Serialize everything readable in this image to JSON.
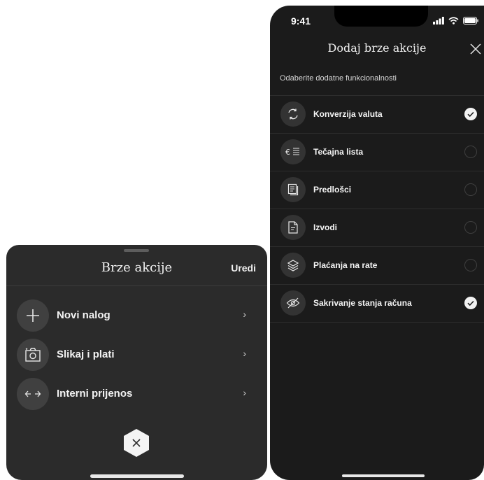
{
  "quick_actions_sheet": {
    "title": "Brze akcije",
    "edit_label": "Uredi",
    "items": [
      {
        "label": "Novi nalog",
        "icon": "plus-icon"
      },
      {
        "label": "Slikaj i plati",
        "icon": "camera-icon"
      },
      {
        "label": "Interni prijenos",
        "icon": "transfer-arrows-icon"
      }
    ],
    "close_icon": "close-icon"
  },
  "add_actions_screen": {
    "status_time": "9:41",
    "title": "Dodaj brze akcije",
    "subtitle": "Odaberite dodatne funkcionalnosti",
    "options": [
      {
        "label": "Konverzija valuta",
        "icon": "currency-conversion-icon",
        "checked": true
      },
      {
        "label": "Tečajna lista",
        "icon": "exchange-rate-list-icon",
        "checked": false
      },
      {
        "label": "Predlošci",
        "icon": "templates-icon",
        "checked": false
      },
      {
        "label": "Izvodi",
        "icon": "statement-document-icon",
        "checked": false
      },
      {
        "label": "Plaćanja na rate",
        "icon": "layers-icon",
        "checked": false
      },
      {
        "label": "Sakrivanje stanja računa",
        "icon": "eye-hidden-icon",
        "checked": true
      }
    ]
  },
  "colors": {
    "sheet_bg": "#2b2b2b",
    "screen_bg": "#1b1b1b",
    "text": "#f1f1f1"
  }
}
